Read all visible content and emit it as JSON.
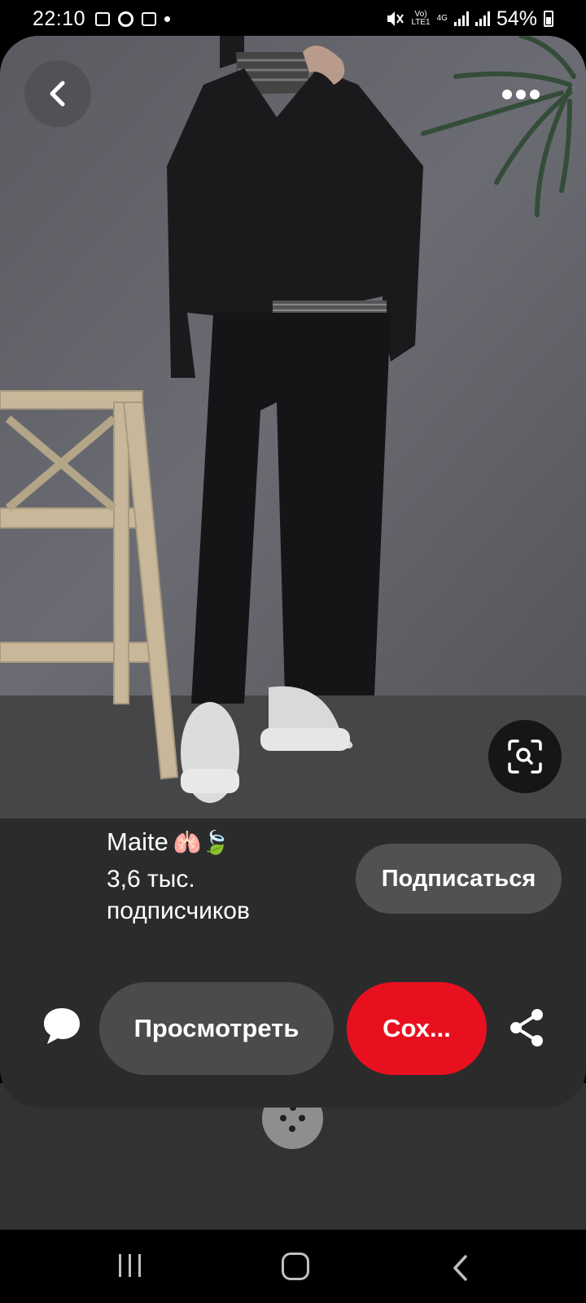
{
  "status_bar": {
    "time": "22:10",
    "network_top": "Vo)",
    "network_bottom": "LTE1",
    "network_type": "4G",
    "battery": "54%",
    "icons": [
      "image-icon",
      "chrome-icon",
      "calendar-icon",
      "dot-icon",
      "mute-icon",
      "signal-icon",
      "battery-icon"
    ]
  },
  "pin": {
    "author": {
      "name": "Maite",
      "emoji": "🫁🍃",
      "followers": "3,6 тыс. подписчиков"
    },
    "follow_label": "Подписаться",
    "view_label": "Просмотреть",
    "save_label": "Сох..."
  },
  "colors": {
    "save_button": "#e8101f",
    "card_background": "#2b2b2c",
    "button_gray": "#4b4b4c"
  },
  "nav_bar": {
    "icons": [
      "recent-apps-icon",
      "home-icon",
      "back-nav-icon"
    ]
  }
}
